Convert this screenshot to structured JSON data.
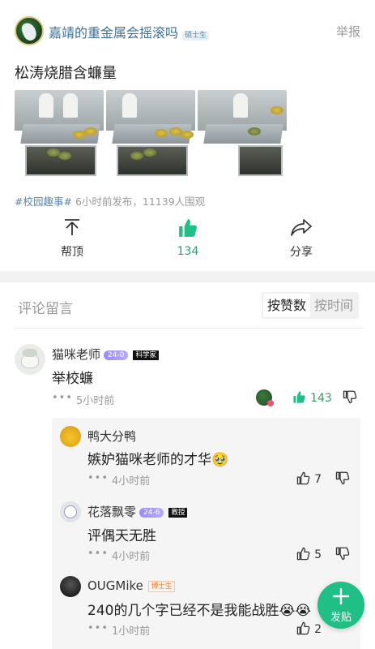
{
  "post": {
    "author_name": "嘉靖的重金属会摇滚吗",
    "author_badge": "硕士生",
    "report_label": "举报",
    "title": "松涛烧腊含蠊量",
    "tag": "#校园趣事#",
    "meta": "6小时前发布，11139人围观"
  },
  "actions": {
    "pin_label": "帮顶",
    "like_count": "134",
    "share_label": "分享"
  },
  "comments_section": {
    "title": "评论留言",
    "sort_by_likes": "按赞数",
    "sort_by_time": "按时间"
  },
  "comment": {
    "name": "猫咪老师",
    "level": "24-0",
    "badge": "科学家",
    "text": "举校蠊",
    "dots": "•••",
    "time": "5小时前",
    "likes": "143"
  },
  "replies": [
    {
      "name": "鸭大分鸭",
      "level": "",
      "badge": "",
      "text": "嫉妒猫咪老师的才华🥹",
      "time": "4小时前",
      "likes": "7"
    },
    {
      "name": "花落飘零",
      "level": "24-6",
      "badge": "教授",
      "text": "评偶天无胜",
      "time": "4小时前",
      "likes": "5"
    },
    {
      "name": "OUGMike",
      "level": "",
      "badge": "博士生",
      "text": "240的几个字已经不是我能战胜😭😭",
      "time": "1小时前",
      "likes": "2"
    }
  ],
  "fab": {
    "label": "发贴"
  },
  "colors": {
    "accent_green": "#1fbf85",
    "link_blue": "#3f6f9a"
  }
}
